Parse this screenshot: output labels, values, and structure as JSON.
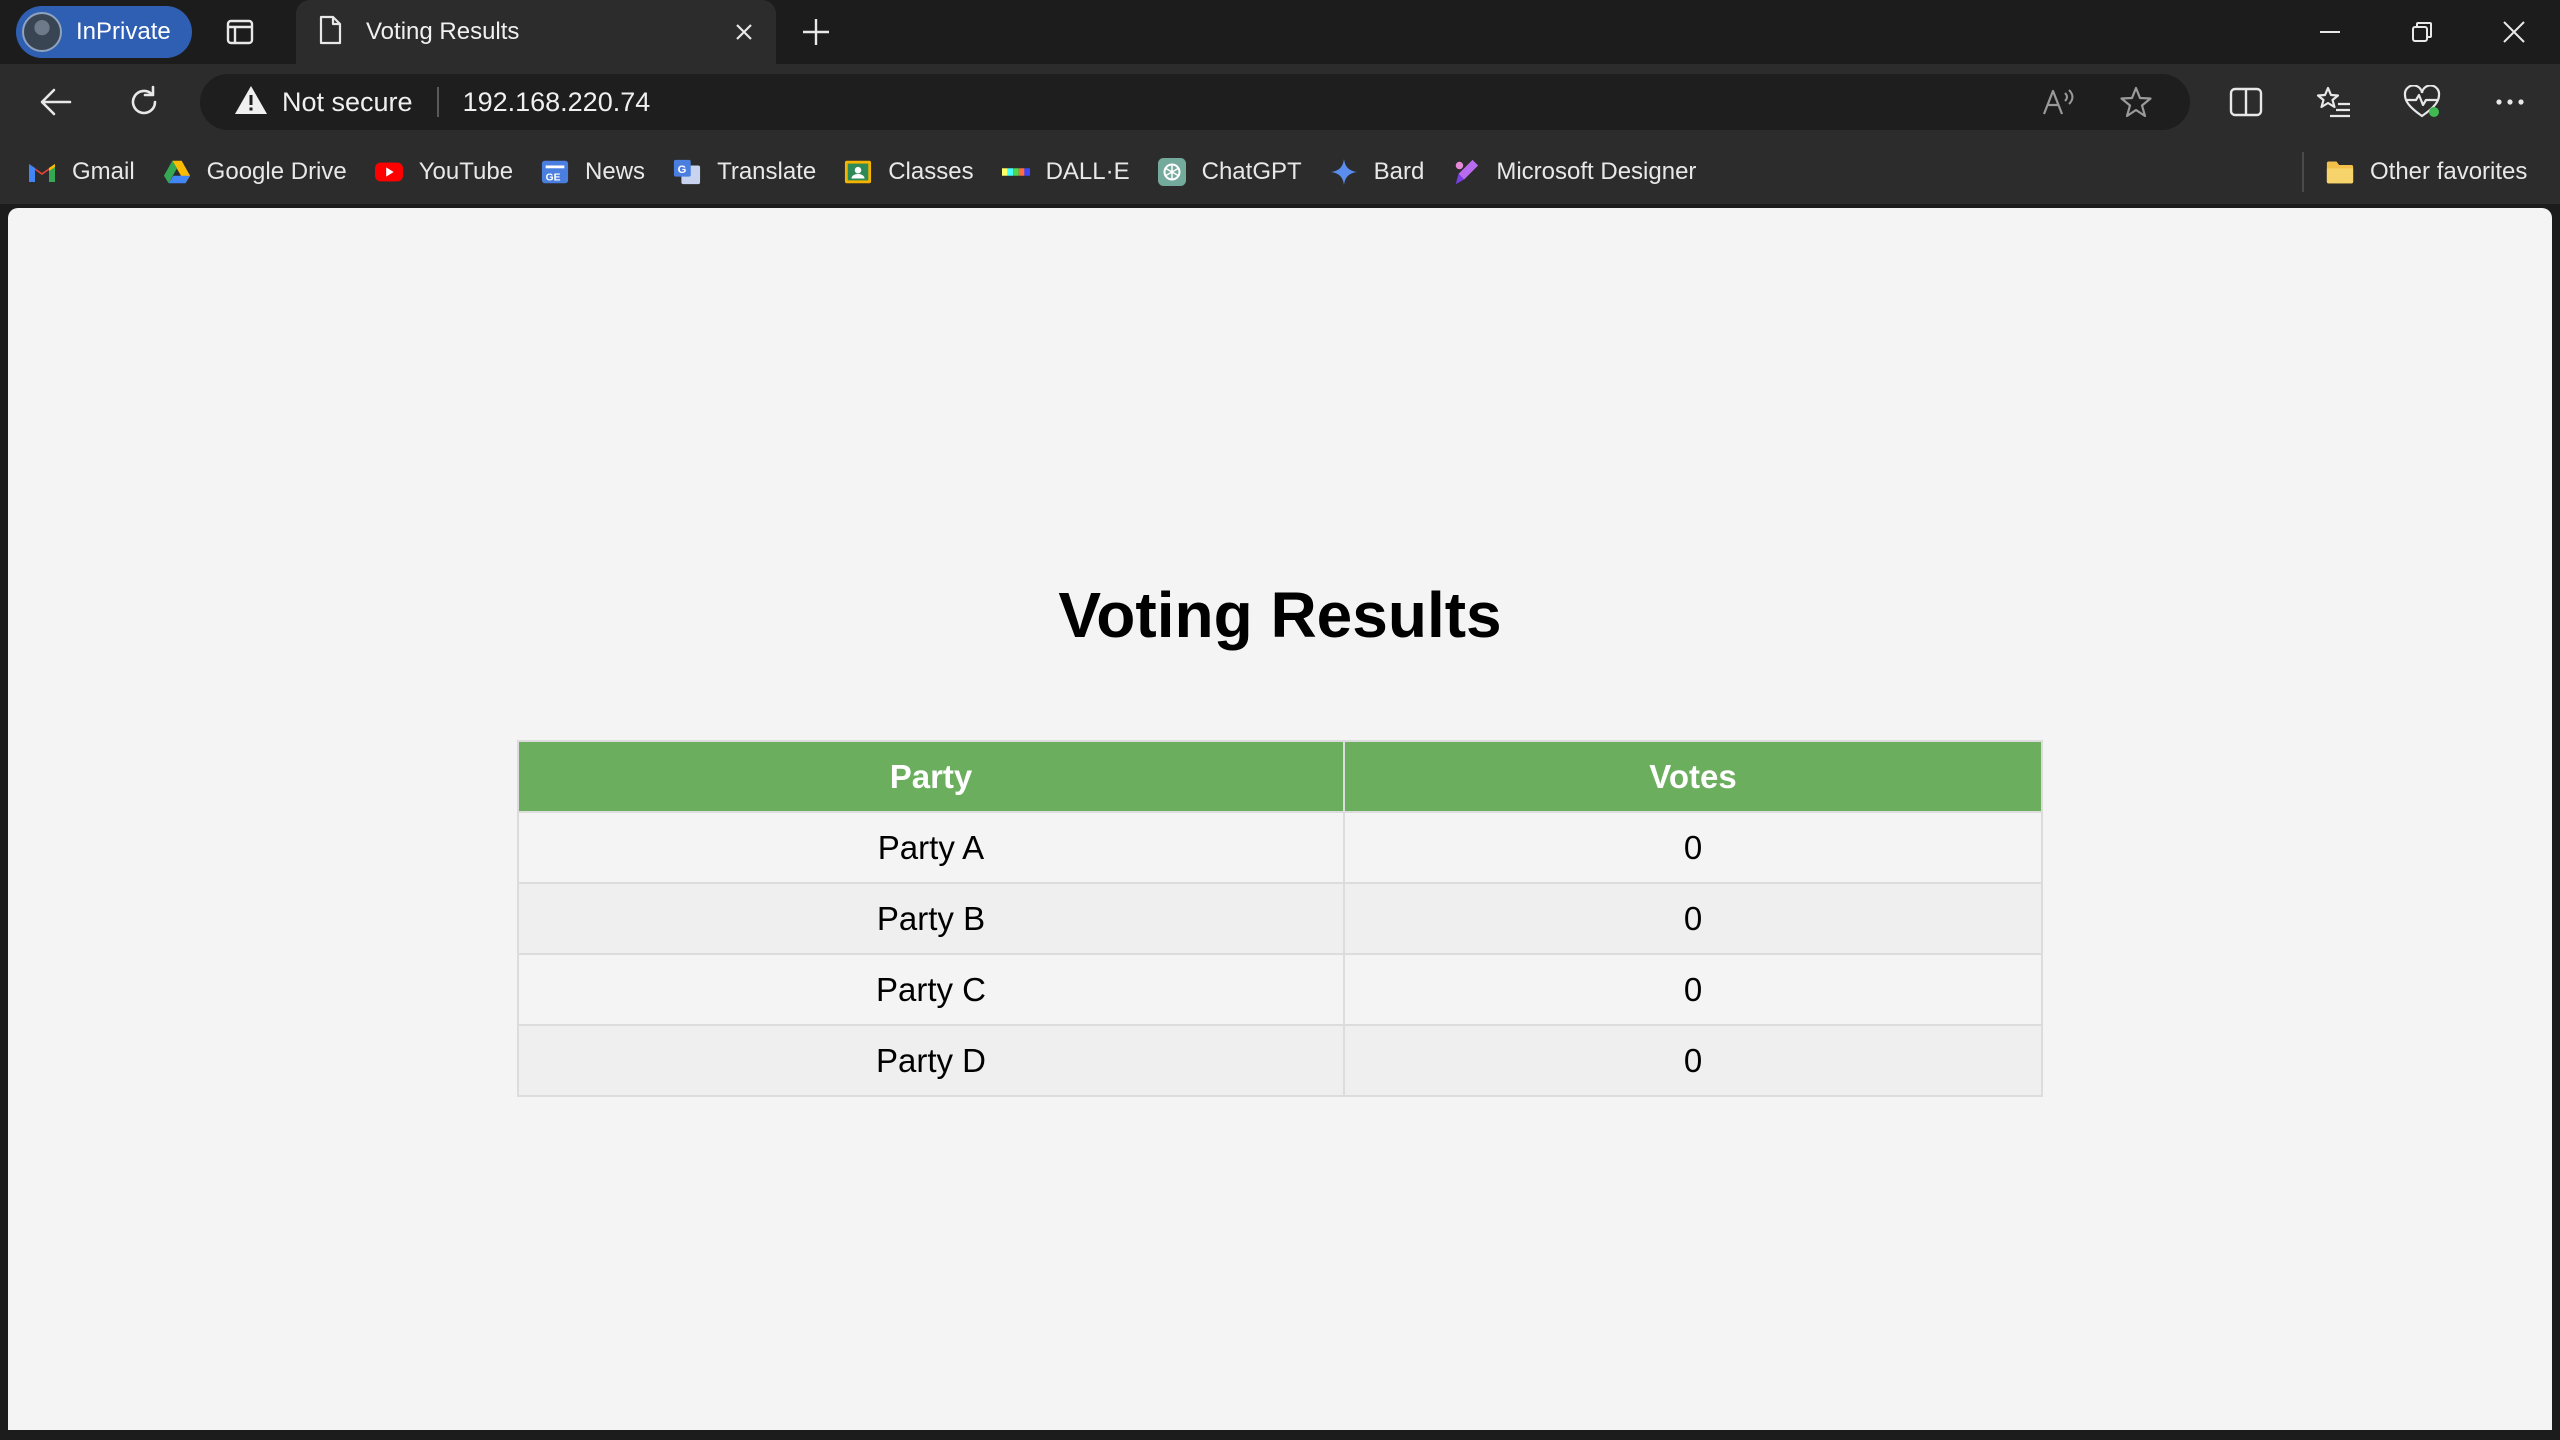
{
  "browser": {
    "profile_label": "InPrivate",
    "tab": {
      "title": "Voting Results"
    },
    "address": {
      "security_label": "Not secure",
      "url": "192.168.220.74"
    },
    "favorites": [
      {
        "label": "Gmail",
        "icon": "gmail-icon"
      },
      {
        "label": "Google Drive",
        "icon": "google-drive-icon"
      },
      {
        "label": "YouTube",
        "icon": "youtube-icon"
      },
      {
        "label": "News",
        "icon": "news-icon"
      },
      {
        "label": "Translate",
        "icon": "translate-icon"
      },
      {
        "label": "Classes",
        "icon": "classes-icon"
      },
      {
        "label": "DALL·E",
        "icon": "dalle-icon"
      },
      {
        "label": "ChatGPT",
        "icon": "chatgpt-icon"
      },
      {
        "label": "Bard",
        "icon": "bard-icon"
      },
      {
        "label": "Microsoft Designer",
        "icon": "designer-icon"
      }
    ],
    "other_favorites": "Other favorites"
  },
  "page": {
    "title": "Voting Results",
    "table": {
      "headers": [
        "Party",
        "Votes"
      ],
      "rows": [
        [
          "Party A",
          "0"
        ],
        [
          "Party B",
          "0"
        ],
        [
          "Party C",
          "0"
        ],
        [
          "Party D",
          "0"
        ]
      ]
    }
  },
  "colors": {
    "header_green": "#6aae5e",
    "chrome_dark": "#1c1c1c",
    "inprivate_blue": "#2f5fb3"
  }
}
